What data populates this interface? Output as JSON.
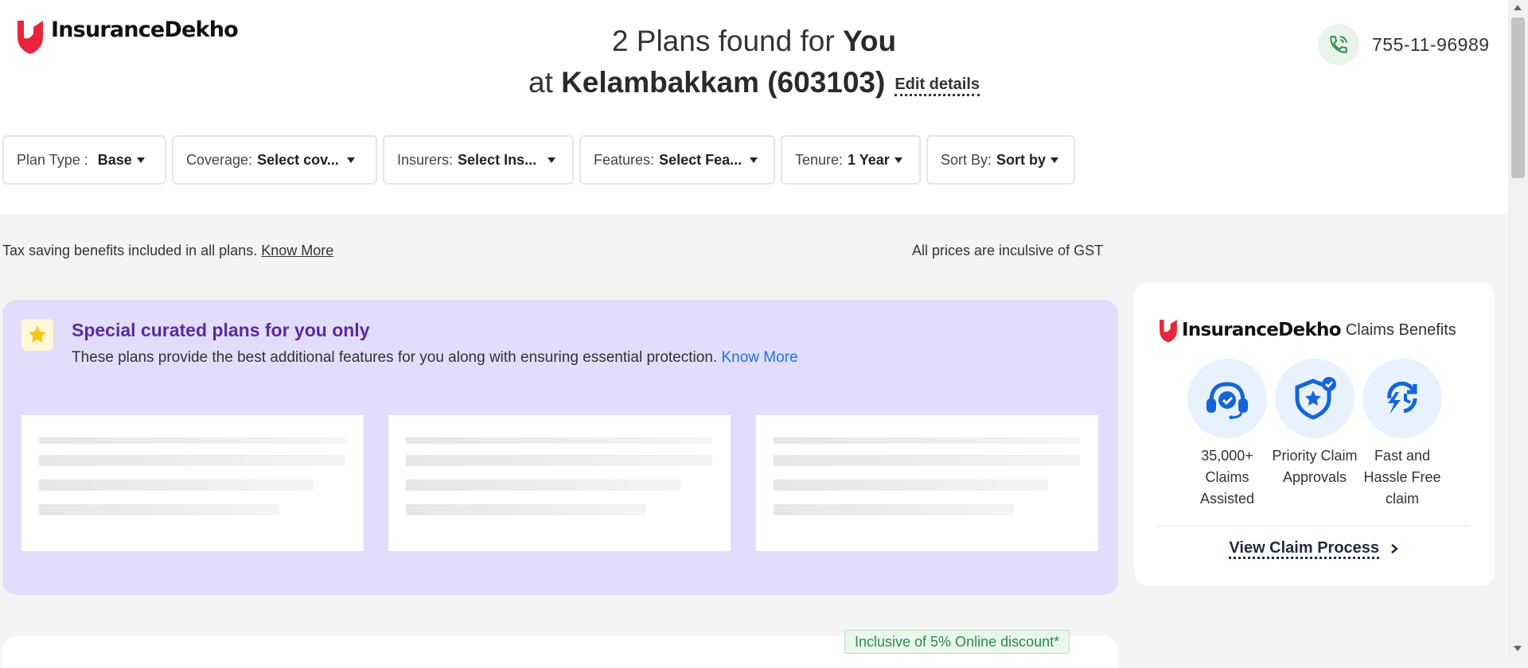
{
  "brand": {
    "name": "InsuranceDekho",
    "accent_color": "#e8253a"
  },
  "header": {
    "line1_prefix": "2 Plans found for ",
    "line1_strong": "You",
    "line2_prefix": "at ",
    "line2_strong": "Kelambakkam (603103)",
    "edit_label": "Edit details",
    "phone_icon": "phone-icon",
    "phone_number": "755-11-96989"
  },
  "filters": [
    {
      "label": "Plan Type :",
      "value": "Base"
    },
    {
      "label": "Coverage:",
      "value": "Select cov..."
    },
    {
      "label": "Insurers:",
      "value": "Select Ins..."
    },
    {
      "label": "Features:",
      "value": "Select Fea..."
    },
    {
      "label": "Tenure:",
      "value": "1 Year"
    },
    {
      "label": "Sort By:",
      "value": "Sort by"
    }
  ],
  "notes": {
    "tax_text": "Tax saving benefits included in all plans.",
    "tax_link": "Know More",
    "gst_text": "All prices are inculsive of GST"
  },
  "curated": {
    "icon": "star-icon",
    "title": "Special curated plans for you only",
    "description": "These plans provide the best additional features for you along with ensuring essential protection.",
    "link": "Know More",
    "background_color": "#e1ddfb"
  },
  "claims": {
    "brand": "InsuranceDekho",
    "heading": "Claims Benefits",
    "benefits": [
      {
        "icon": "headset-icon",
        "line1": "35,000+",
        "line2": "Claims",
        "line3": "Assisted"
      },
      {
        "icon": "shield-star-icon",
        "line1": "Priority Claim",
        "line2": "Approvals",
        "line3": ""
      },
      {
        "icon": "fast-refresh-icon",
        "line1": "Fast and",
        "line2": "Hassle Free",
        "line3": "claim"
      }
    ],
    "cta": "View Claim Process",
    "cta_icon": "chevron-right-icon"
  },
  "discount_badge": "Inclusive of 5% Online discount*"
}
